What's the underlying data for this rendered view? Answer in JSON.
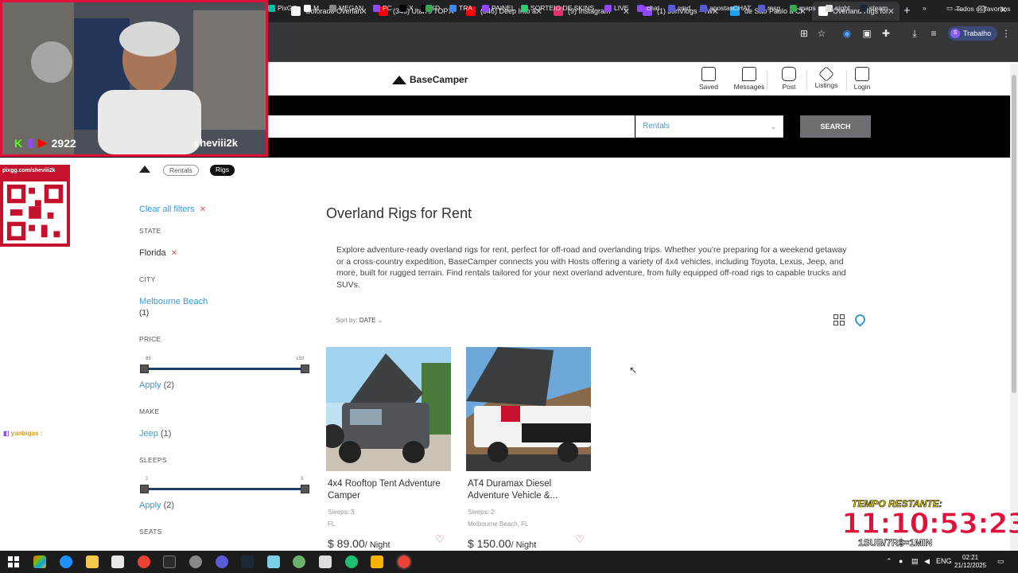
{
  "browser": {
    "tabs": [
      {
        "label": "Colorado Overlan",
        "color": "#f4f4f4"
      },
      {
        "label": "(346) Utah's TOP",
        "color": "#ff0000"
      },
      {
        "label": "(346) Deep Into a",
        "color": "#ff0000"
      },
      {
        "label": "(9) Instagram",
        "color": "#e1306c"
      },
      {
        "label": "(1) JonVlogs - Tw",
        "color": "#9146ff"
      },
      {
        "label": "de São Paulo a Cl",
        "color": "#1da1f2"
      },
      {
        "label": "Overland Rigs for",
        "color": "#ffffff"
      }
    ],
    "new_tab_label": "+",
    "profile_label": "Trabalho",
    "profile_initial": "S",
    "bookmarks": [
      {
        "label": "PixGG",
        "color": "#00c2a8"
      },
      {
        "label": "M",
        "color": "#ffffff"
      },
      {
        "label": "MEGAN",
        "color": "#888888"
      },
      {
        "label": "PC",
        "color": "#9146ff"
      },
      {
        "label": "X",
        "color": "#000000"
      },
      {
        "label": "X",
        "color": "#000000"
      },
      {
        "label": "D",
        "color": "#34a853"
      },
      {
        "label": "TRA",
        "color": "#4285f4"
      },
      {
        "label": "PAINEL",
        "color": "#9146ff"
      },
      {
        "label": "SORTEIO DE SKINS...",
        "color": "#2ecc71"
      },
      {
        "label": "LIVE",
        "color": "#9146ff"
      },
      {
        "label": "chat",
        "color": "#9146ff"
      },
      {
        "label": "cmd",
        "color": "#5b5bd6"
      },
      {
        "label": "apostasCHAT",
        "color": "#5b5bd6"
      },
      {
        "label": "msg",
        "color": "#5b5bd6"
      },
      {
        "label": "maps",
        "color": "#34a853"
      },
      {
        "label": "night",
        "color": "#dddddd"
      },
      {
        "label": "steam",
        "color": "#1b2838"
      }
    ],
    "bookmarks_overflow": "»",
    "favorites_folder": "Todos os favoritos"
  },
  "site": {
    "logo_text": "BaseCamper",
    "nav": [
      {
        "label": "Saved",
        "icon": "bookmark-icon"
      },
      {
        "label": "Messages",
        "icon": "chat-icon"
      },
      {
        "label": "Post",
        "icon": "camera-plus-icon"
      },
      {
        "label": "Listings",
        "icon": "tag-icon"
      },
      {
        "label": "Login",
        "icon": "login-icon"
      }
    ],
    "search": {
      "placeholder": "",
      "category_value": "Rentals",
      "button_label": "SEARCH"
    },
    "breadcrumb": [
      "Rentals",
      "Rigs"
    ]
  },
  "filters": {
    "clear_all": "Clear all filters",
    "state_header": "STATE",
    "state_value": "Florida",
    "city_header": "CITY",
    "city_value": "Melbourne Beach",
    "city_count": "(1)",
    "price_header": "PRICE",
    "price_min": "89",
    "price_max": "150",
    "price_apply": "Apply",
    "price_apply_count": "(2)",
    "make_header": "MAKE",
    "make_value": "Jeep",
    "make_count": "(1)",
    "sleeps_header": "SLEEPS",
    "sleeps_min": "2",
    "sleeps_max": "3",
    "sleeps_apply": "Apply",
    "sleeps_apply_count": "(2)",
    "seats_header": "SEATS"
  },
  "main": {
    "title": "Overland Rigs for Rent",
    "intro": "Explore adventure-ready overland rigs for rent, perfect for off-road and overlanding trips. Whether you're preparing for a weekend getaway or a cross-country expedition, BaseCamper connects you with Hosts offering a variety of 4x4 vehicles, including Toyota, Lexus, Jeep, and more, built for rugged terrain. Find rentals tailored for your next overland adventure, from fully equipped off-road rigs to capable trucks and SUVs.",
    "sort_label": "Sort by:",
    "sort_value": "DATE",
    "listings": [
      {
        "title": "4x4 Rooftop Tent Adventure Camper",
        "sleeps": "Sleeps: 3",
        "location": "FL",
        "price": "$ 89.00",
        "unit": "/ Night"
      },
      {
        "title": "AT4 Duramax Diesel Adventure Vehicle &...",
        "sleeps": "Sleeps: 2",
        "location": "Melbourne Beach, FL",
        "price": "$ 150.00",
        "unit": "/ Night"
      }
    ]
  },
  "overlay": {
    "viewers": "2922",
    "streamer": "sheviii2k",
    "pix_url": "pixgg.com/sheviii2k",
    "chat_user": "yanbigas :",
    "timer_label": "TEMPO RESTANTE:",
    "timer_value": "11:10:53:23",
    "timer_sub": "1SUB/7R$=1MIN"
  },
  "taskbar": {
    "lang": "ENG",
    "time": "02:21",
    "date": "21/12/2025"
  }
}
